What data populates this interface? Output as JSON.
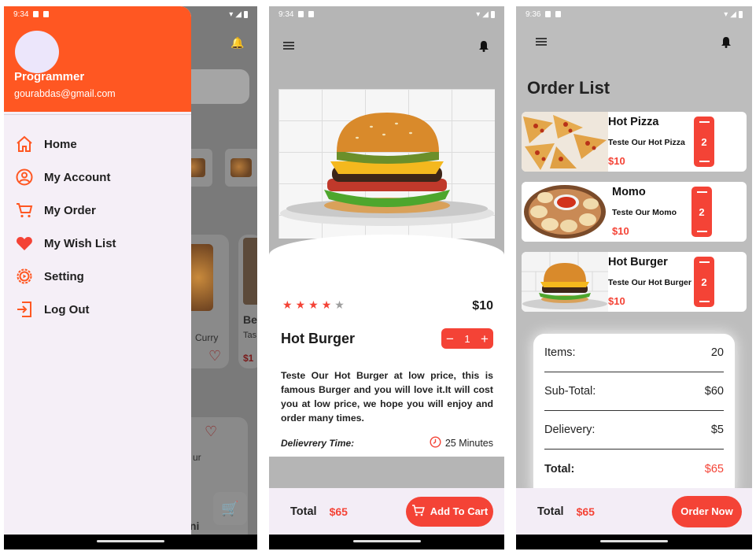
{
  "colors": {
    "accent": "#ff5722",
    "red": "#f44336",
    "drawer_bg": "#f5eff7"
  },
  "screen1": {
    "status_time": "9:34",
    "drawer": {
      "name": "Programmer",
      "email": "gourabdas@gmail.com",
      "items": [
        {
          "label": "Home",
          "icon": "home-icon"
        },
        {
          "label": "My Account",
          "icon": "account-icon"
        },
        {
          "label": "My Order",
          "icon": "cart-icon"
        },
        {
          "label": "My Wish List",
          "icon": "heart-icon"
        },
        {
          "label": "Setting",
          "icon": "settings-icon"
        },
        {
          "label": "Log Out",
          "icon": "logout-icon"
        }
      ]
    },
    "background": {
      "card1_text": "Curry",
      "card2_title": "Be",
      "card2_sub": "Tas",
      "card2_price": "$1",
      "card3_text": "ur",
      "card3_bottom": "ni"
    }
  },
  "screen2": {
    "status_time": "9:34",
    "rating": 4,
    "rating_max": 5,
    "price": "$10",
    "title": "Hot Burger",
    "quantity": "1",
    "description": "Teste Our Hot Burger at low price, this is famous Burger and you will love it.It will cost you at low price, we hope you will enjoy and order many times.",
    "delivery_label": "Delievrery Time:",
    "delivery_time": "25 Minutes",
    "total_label": "Total",
    "total_value": "$65",
    "add_to_cart": "Add To Cart"
  },
  "screen3": {
    "status_time": "9:36",
    "title": "Order List",
    "orders": [
      {
        "name": "Hot Pizza",
        "sub": "Teste Our Hot Pizza",
        "price": "$10",
        "qty": "2"
      },
      {
        "name": "Momo",
        "sub": "Teste Our Momo",
        "price": "$10",
        "qty": "2"
      },
      {
        "name": "Hot Burger",
        "sub": "Teste Our Hot Burger",
        "price": "$10",
        "qty": "2"
      }
    ],
    "summary": [
      {
        "label": "Items:",
        "value": "20"
      },
      {
        "label": "Sub-Total:",
        "value": "$60"
      },
      {
        "label": "Delievery:",
        "value": "$5"
      },
      {
        "label": "Total:",
        "value": "$65"
      }
    ],
    "total_label": "Total",
    "total_value": "$65",
    "order_now": "Order Now"
  }
}
